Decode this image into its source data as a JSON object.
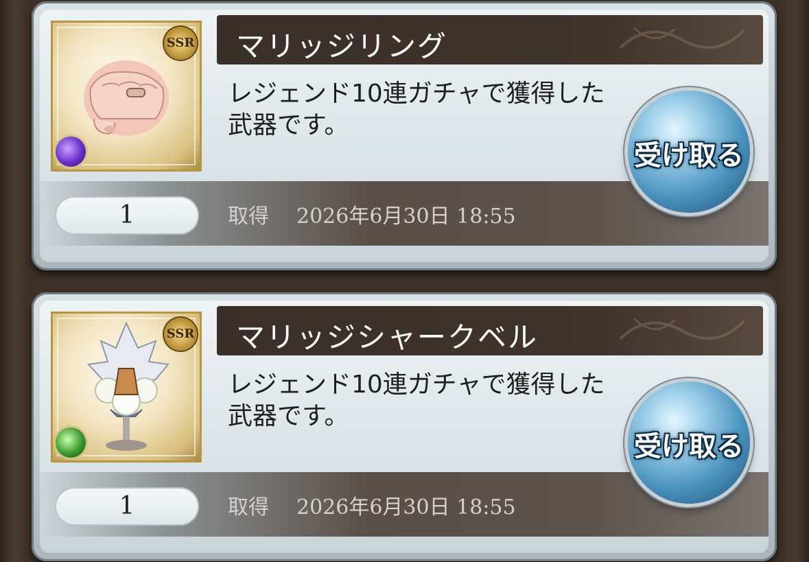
{
  "items": [
    {
      "name": "マリッジリング",
      "rarity": "SSR",
      "element": "dark",
      "description": "レジェンド10連ガチャで獲得した武器です。",
      "quantity": "1",
      "acquired_label": "取得",
      "acquired_datetime": "2026年6月30日  18:55",
      "receive_label": "受け取る",
      "thumbnail_icon": "ring-hand-icon"
    },
    {
      "name": "マリッジシャークベル",
      "rarity": "SSR",
      "element": "wind",
      "description": "レジェンド10連ガチャで獲得した武器です。",
      "quantity": "1",
      "acquired_label": "取得",
      "acquired_datetime": "2026年6月30日  18:55",
      "receive_label": "受け取る",
      "thumbnail_icon": "chalice-bouquet-icon"
    }
  ]
}
